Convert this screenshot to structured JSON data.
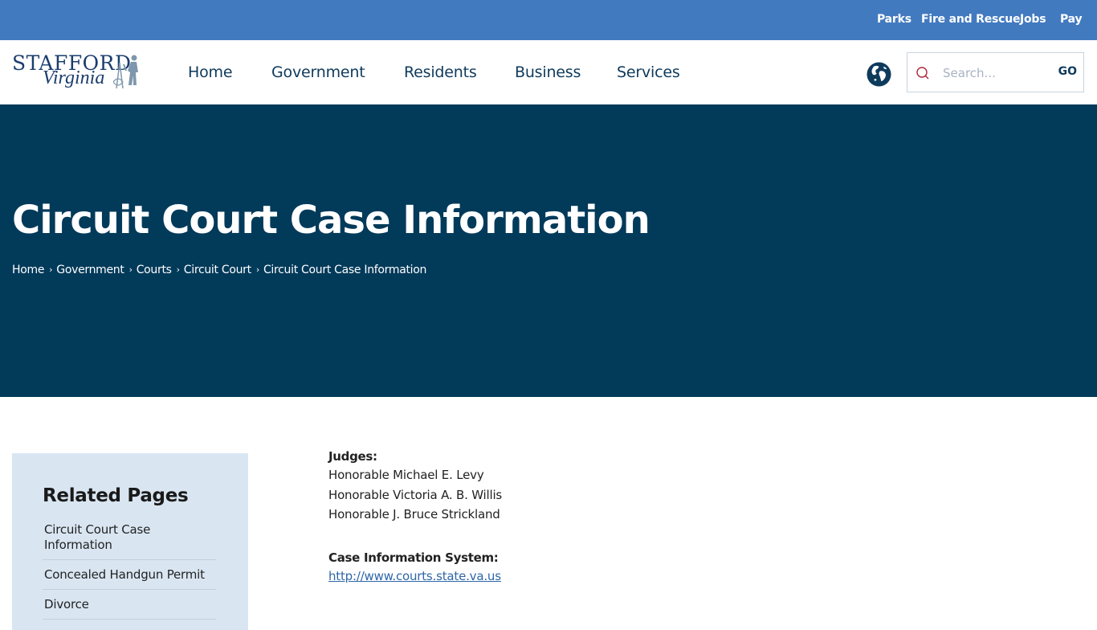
{
  "topbar": {
    "links": [
      "Parks",
      "Fire and Rescue",
      "Jobs",
      "Pay"
    ]
  },
  "logo": {
    "line1": "STAFFORD",
    "line2": "Virginia"
  },
  "nav": {
    "items": [
      "Home",
      "Government",
      "Residents",
      "Business",
      "Services"
    ]
  },
  "search": {
    "placeholder": "Search...",
    "go_label": "GO"
  },
  "hero": {
    "title": "Circuit Court Case Information",
    "breadcrumb": [
      "Home",
      "Government",
      "Courts",
      "Circuit Court",
      "Circuit Court Case Information"
    ],
    "separator": "›"
  },
  "sidebar": {
    "title": "Related Pages",
    "items": [
      "Circuit Court Case Information",
      "Concealed Handgun Permit",
      "Divorce"
    ]
  },
  "content": {
    "judges_label": "Judges:",
    "judges": [
      "Honorable Michael E. Levy",
      "Honorable Victoria A. B. Willis",
      "Honorable J. Bruce Strickland"
    ],
    "case_system_label": "Case Information System:",
    "case_system_link": "http://www.courts.state.va.us"
  },
  "colors": {
    "topbar": "#427ac0",
    "hero": "#023a5a",
    "nav_text": "#0e3a5c",
    "sidebar_bg": "#d9e6f2",
    "link": "#2e66a8"
  }
}
